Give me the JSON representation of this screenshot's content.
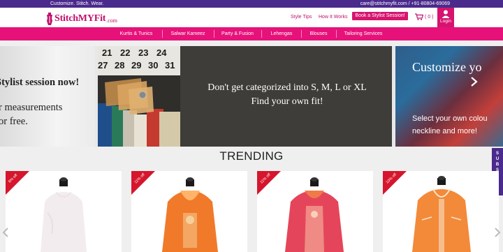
{
  "topbar": {
    "tagline": "Customize. Stitch. Wear.",
    "contact": "care@stitchmyfit.com / +91-80804-69069"
  },
  "header": {
    "logo_name": "StitchMYFit",
    "logo_domain": ".com",
    "links": [
      "Style Tips",
      "How It Works"
    ],
    "book_button": "Book a Stylist Session!",
    "cart_count": "( 0 )",
    "login_label": "Login"
  },
  "nav": {
    "items": [
      "Kurtis & Tunics",
      "Salwar Kameez",
      "Party & Fusion",
      "Lehengas",
      "Blouses",
      "Tailoring Services"
    ]
  },
  "carousel": {
    "slide1": {
      "line1": "Stylist session now!",
      "line2": "r measurements",
      "line3": "or free."
    },
    "slide2": {
      "line1": "Don't get categorized into S, M, L or XL",
      "line2": "Find your own fit!",
      "tags_row1": [
        "21",
        "22",
        "23",
        "24"
      ],
      "tags_row2": [
        "27",
        "28",
        "29",
        "30",
        "31"
      ]
    },
    "slide3": {
      "title": "Customize yo",
      "line1": "Select your own colou",
      "line2": "neckline and more!"
    }
  },
  "subscribe_label": "SUBSCRIBE",
  "trending": {
    "title": "TRENDING",
    "products": [
      {
        "discount": "6% off",
        "color": "#f1e9ea",
        "accent": "#ffffff"
      },
      {
        "discount": "11% off",
        "color": "#f07a2a",
        "accent": "#f5c48a"
      },
      {
        "discount": "11% off",
        "color": "#e5455a",
        "accent": "#f7c2a8"
      },
      {
        "discount": "10% off",
        "color": "#f28a3a",
        "accent": "#f9d4b0"
      }
    ]
  },
  "colors": {
    "brand": "#e6127a",
    "topbar": "#4a2a8c",
    "ribbon": "#d5162c"
  }
}
